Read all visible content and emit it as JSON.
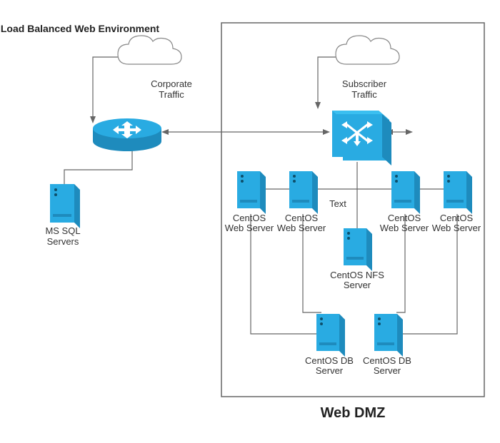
{
  "title": "Load Balanced Web Environment",
  "dmz_title": "Web DMZ",
  "labels": {
    "corporate_traffic_l1": "Corporate",
    "corporate_traffic_l2": "Traffic",
    "subscriber_traffic_l1": "Subscriber",
    "subscriber_traffic_l2": "Traffic",
    "text_placeholder": "Text",
    "mssql_l1": "MS SQL",
    "mssql_l2": "Servers",
    "centos_web_l1": "CentOS",
    "centos_web_l2": "Web Server",
    "centos_nfs_l1": "CentOS NFS",
    "centos_nfs_l2": "Server",
    "centos_db_l1": "CentOS DB",
    "centos_db_l2": "Server"
  },
  "nodes": [
    {
      "id": "cloud-left",
      "type": "cloud",
      "name": "corporate-cloud"
    },
    {
      "id": "cloud-right",
      "type": "cloud",
      "name": "subscriber-cloud"
    },
    {
      "id": "router",
      "type": "router",
      "name": "router"
    },
    {
      "id": "switch",
      "type": "switch",
      "name": "core-switch"
    },
    {
      "id": "mssql",
      "type": "server",
      "name": "mssql-server"
    },
    {
      "id": "web1",
      "type": "server",
      "name": "centos-web-1"
    },
    {
      "id": "web2",
      "type": "server",
      "name": "centos-web-2"
    },
    {
      "id": "web3",
      "type": "server",
      "name": "centos-web-3"
    },
    {
      "id": "web4",
      "type": "server",
      "name": "centos-web-4"
    },
    {
      "id": "nfs",
      "type": "server",
      "name": "centos-nfs"
    },
    {
      "id": "db1",
      "type": "server",
      "name": "centos-db-1"
    },
    {
      "id": "db2",
      "type": "server",
      "name": "centos-db-2"
    }
  ]
}
